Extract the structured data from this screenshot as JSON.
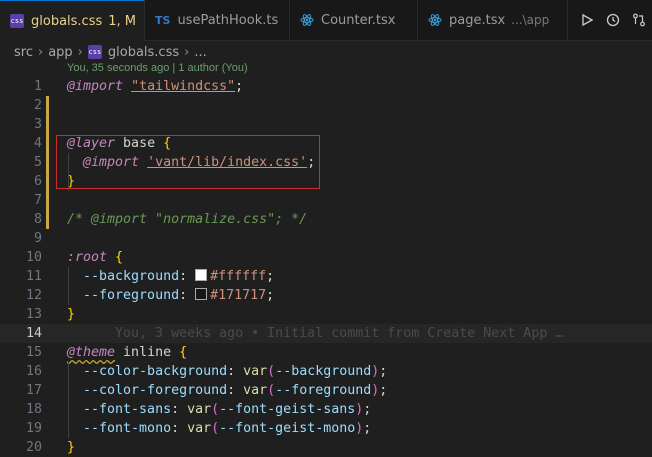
{
  "tabs": [
    {
      "label": "globals.css",
      "status": "1, M",
      "icon": "css-icon",
      "icon_text": "css",
      "active": true
    },
    {
      "label": "usePathHook.ts",
      "icon": "typescript-icon",
      "icon_text": "TS"
    },
    {
      "label": "Counter.tsx",
      "icon": "react-icon"
    },
    {
      "label": "page.tsx",
      "desc": "...\\app",
      "icon": "react-icon"
    }
  ],
  "breadcrumb": {
    "items": [
      "src",
      "app",
      "globals.css",
      "..."
    ],
    "icon_text": "css"
  },
  "lens": "You, 35 seconds ago | 1 author (You)",
  "ghost_blame": "You, 3 weeks ago • Initial commit from Create Next App …",
  "colors": {
    "white_swatch": "#ffffff",
    "dark_swatch": "#171717",
    "accent": "#0078d4",
    "highlight_box": "#d02b2b"
  },
  "lines": [
    {
      "n": "1",
      "tokens": [
        {
          "c": "k-at",
          "t": "@import"
        },
        {
          "c": "pl",
          "t": " "
        },
        {
          "c": "str-u",
          "t": "\"tailwindcss\""
        },
        {
          "c": "pl",
          "t": ";"
        }
      ]
    },
    {
      "n": "2",
      "tokens": []
    },
    {
      "n": "3",
      "tokens": []
    },
    {
      "n": "4",
      "tokens": [
        {
          "c": "k-at",
          "t": "@layer"
        },
        {
          "c": "pl",
          "t": " base "
        },
        {
          "c": "br1",
          "t": "{"
        }
      ]
    },
    {
      "n": "5",
      "tokens": [
        {
          "c": "pl",
          "t": "  "
        },
        {
          "c": "k-at",
          "t": "@import"
        },
        {
          "c": "pl",
          "t": " "
        },
        {
          "c": "str-u",
          "t": "'vant/lib/index.css'"
        },
        {
          "c": "pl",
          "t": ";"
        }
      ]
    },
    {
      "n": "6",
      "tokens": [
        {
          "c": "br1",
          "t": "}"
        }
      ]
    },
    {
      "n": "7",
      "tokens": []
    },
    {
      "n": "8",
      "tokens": [
        {
          "c": "com",
          "t": "/* @import \"normalize.css\"; */"
        }
      ]
    },
    {
      "n": "9",
      "tokens": []
    },
    {
      "n": "10",
      "tokens": [
        {
          "c": "k-at",
          "t": ":root"
        },
        {
          "c": "pl",
          "t": " "
        },
        {
          "c": "br1",
          "t": "{"
        }
      ]
    },
    {
      "n": "11",
      "tokens": [
        {
          "c": "pl",
          "t": "  "
        },
        {
          "c": "prop",
          "t": "--background"
        },
        {
          "c": "pl",
          "t": ": "
        },
        {
          "c": "swatch",
          "t": "#ffffff"
        },
        {
          "c": "str",
          "t": "#ffffff"
        },
        {
          "c": "pl",
          "t": ";"
        }
      ]
    },
    {
      "n": "12",
      "tokens": [
        {
          "c": "pl",
          "t": "  "
        },
        {
          "c": "prop",
          "t": "--foreground"
        },
        {
          "c": "pl",
          "t": ": "
        },
        {
          "c": "swatch",
          "t": "#171717"
        },
        {
          "c": "str",
          "t": "#171717"
        },
        {
          "c": "pl",
          "t": ";"
        }
      ]
    },
    {
      "n": "13",
      "tokens": [
        {
          "c": "br1",
          "t": "}"
        }
      ]
    },
    {
      "n": "14",
      "tokens": [
        {
          "c": "ghost",
          "t": "      You, 3 weeks ago • Initial commit from Create Next App …"
        }
      ],
      "current": true
    },
    {
      "n": "15",
      "tokens": [
        {
          "c": "k-at wavy",
          "t": "@theme"
        },
        {
          "c": "pl",
          "t": " inline "
        },
        {
          "c": "br1",
          "t": "{"
        }
      ]
    },
    {
      "n": "16",
      "tokens": [
        {
          "c": "pl",
          "t": "  "
        },
        {
          "c": "prop",
          "t": "--color-background"
        },
        {
          "c": "pl",
          "t": ": "
        },
        {
          "c": "fn",
          "t": "var"
        },
        {
          "c": "br2",
          "t": "("
        },
        {
          "c": "prop",
          "t": "--background"
        },
        {
          "c": "br2",
          "t": ")"
        },
        {
          "c": "pl",
          "t": ";"
        }
      ]
    },
    {
      "n": "17",
      "tokens": [
        {
          "c": "pl",
          "t": "  "
        },
        {
          "c": "prop",
          "t": "--color-foreground"
        },
        {
          "c": "pl",
          "t": ": "
        },
        {
          "c": "fn",
          "t": "var"
        },
        {
          "c": "br2",
          "t": "("
        },
        {
          "c": "prop",
          "t": "--foreground"
        },
        {
          "c": "br2",
          "t": ")"
        },
        {
          "c": "pl",
          "t": ";"
        }
      ]
    },
    {
      "n": "18",
      "tokens": [
        {
          "c": "pl",
          "t": "  "
        },
        {
          "c": "prop",
          "t": "--font-sans"
        },
        {
          "c": "pl",
          "t": ": "
        },
        {
          "c": "fn",
          "t": "var"
        },
        {
          "c": "br2",
          "t": "("
        },
        {
          "c": "prop",
          "t": "--font-geist-sans"
        },
        {
          "c": "br2",
          "t": ")"
        },
        {
          "c": "pl",
          "t": ";"
        }
      ]
    },
    {
      "n": "19",
      "tokens": [
        {
          "c": "pl",
          "t": "  "
        },
        {
          "c": "prop",
          "t": "--font-mono"
        },
        {
          "c": "pl",
          "t": ": "
        },
        {
          "c": "fn",
          "t": "var"
        },
        {
          "c": "br2",
          "t": "("
        },
        {
          "c": "prop",
          "t": "--font-geist-mono"
        },
        {
          "c": "br2",
          "t": ")"
        },
        {
          "c": "pl",
          "t": ";"
        }
      ]
    },
    {
      "n": "20",
      "tokens": [
        {
          "c": "br1",
          "t": "}"
        }
      ]
    }
  ]
}
